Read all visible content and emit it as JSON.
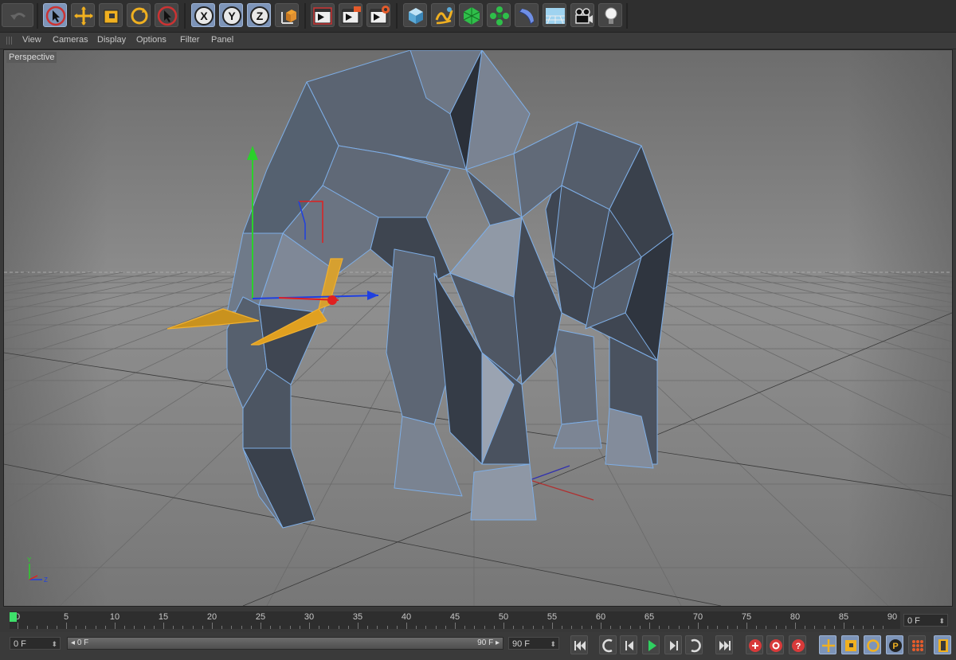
{
  "toolbar": {
    "buttons": [
      {
        "name": "undo-icon"
      },
      {
        "name": "live-selection-icon"
      },
      {
        "name": "move-icon"
      },
      {
        "name": "scale-icon"
      },
      {
        "name": "rotate-icon"
      },
      {
        "name": "last-tool-icon"
      },
      {
        "name": "x-axis-lock-icon",
        "label": "X"
      },
      {
        "name": "y-axis-lock-icon",
        "label": "Y"
      },
      {
        "name": "z-axis-lock-icon",
        "label": "Z"
      },
      {
        "name": "coordinate-system-icon"
      },
      {
        "name": "render-view-icon"
      },
      {
        "name": "render-picture-viewer-icon"
      },
      {
        "name": "render-settings-icon"
      },
      {
        "name": "cube-primitive-icon"
      },
      {
        "name": "spline-pen-icon"
      },
      {
        "name": "subdivision-surface-icon"
      },
      {
        "name": "array-generator-icon"
      },
      {
        "name": "deformer-icon"
      },
      {
        "name": "floor-scene-icon"
      },
      {
        "name": "camera-icon"
      },
      {
        "name": "light-icon"
      }
    ]
  },
  "menu": {
    "items": [
      "View",
      "Cameras",
      "Display",
      "Options",
      "Filter",
      "Panel"
    ]
  },
  "viewport": {
    "label": "Perspective",
    "mini_axis_y": "Y",
    "mini_axis_z": "Z",
    "mesh_color": "#4c5461",
    "wire_color": "#76a7e6",
    "tusk_color": "#e5a21a"
  },
  "timeline": {
    "ticks": [
      "0",
      "5",
      "10",
      "15",
      "20",
      "25",
      "30",
      "35",
      "40",
      "45",
      "50",
      "55",
      "60",
      "65",
      "70",
      "75",
      "80",
      "85",
      "90"
    ],
    "current_frame": "0 F"
  },
  "controls": {
    "start_frame": "0 F",
    "range_start": "0 F",
    "range_end": "90 F",
    "end_frame": "90 F"
  }
}
